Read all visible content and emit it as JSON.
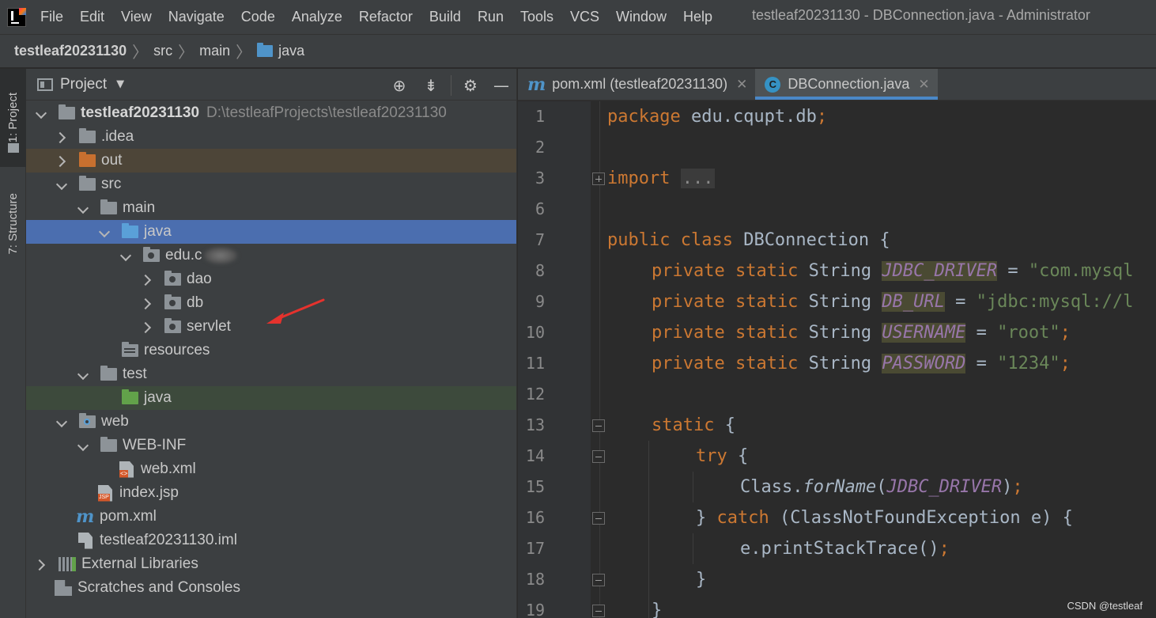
{
  "menu": {
    "items": [
      "File",
      "Edit",
      "View",
      "Navigate",
      "Code",
      "Analyze",
      "Refactor",
      "Build",
      "Run",
      "Tools",
      "VCS",
      "Window",
      "Help"
    ],
    "window_title": "testleaf20231130 - DBConnection.java - Administrator"
  },
  "breadcrumb": {
    "project": "testleaf20231130",
    "src": "src",
    "main": "main",
    "java": "java"
  },
  "side_strip": {
    "project_tab": "1: Project",
    "structure_tab": "7: Structure"
  },
  "project_panel": {
    "title": "Project",
    "tree": {
      "root_name": "testleaf20231130",
      "root_path": "D:\\testleafProjects\\testleaf20231130",
      "idea": ".idea",
      "out": "out",
      "src": "src",
      "main": "main",
      "java": "java",
      "edu_package": "edu.c",
      "dao": "dao",
      "db": "db",
      "servlet": "servlet",
      "resources": "resources",
      "test": "test",
      "test_java": "java",
      "web": "web",
      "web_inf": "WEB-INF",
      "web_xml": "web.xml",
      "index_jsp": "index.jsp",
      "pom_xml": "pom.xml",
      "iml": "testleaf20231130.iml",
      "external_libraries": "External Libraries",
      "scratches": "Scratches and Consoles"
    }
  },
  "editor": {
    "tabs": [
      {
        "label": "pom.xml (testleaf20231130)",
        "icon": "maven-icon"
      },
      {
        "label": "DBConnection.java",
        "icon": "class-icon"
      }
    ],
    "line_numbers": [
      "1",
      "2",
      "3",
      "6",
      "7",
      "8",
      "9",
      "10",
      "11",
      "12",
      "13",
      "14",
      "15",
      "16",
      "17",
      "18",
      "19"
    ],
    "code": {
      "l1_kw": "package",
      "l1_rest": " edu.cqupt.db",
      "l1_semi": ";",
      "l3_kw": "import",
      "l3_fold": "...",
      "l7_kw": "public class",
      "l7_rest": " DBConnection {",
      "l8_kw": "private static",
      "l8_type": " String ",
      "l8_field": "JDBC_DRIVER",
      "l8_eq": " = ",
      "l8_str": "\"com.mysql",
      "l9_kw": "private static",
      "l9_type": " String ",
      "l9_field": "DB_URL",
      "l9_eq": " = ",
      "l9_str": "\"jdbc:mysql://l",
      "l10_kw": "private static",
      "l10_type": " String ",
      "l10_field": "USERNAME",
      "l10_eq": " = ",
      "l10_str": "\"root\"",
      "l10_semi": ";",
      "l11_kw": "private static",
      "l11_type": " String ",
      "l11_field": "PASSWORD",
      "l11_eq": " = ",
      "l11_str": "\"1234\"",
      "l11_semi": ";",
      "l13_kw": "static",
      "l13_rest": " {",
      "l14_kw": "try",
      "l14_rest": " {",
      "l15_a": "Class.",
      "l15_fn": "forName",
      "l15_b": "(",
      "l15_field": "JDBC_DRIVER",
      "l15_c": ")",
      "l15_semi": ";",
      "l16_a": "} ",
      "l16_kw": "catch",
      "l16_rest": " (ClassNotFoundException e) {",
      "l17_a": "e.printStackTrace()",
      "l17_semi": ";",
      "l18_a": "}",
      "l19_a": "}"
    }
  },
  "watermark": "CSDN @testleaf",
  "colors": {
    "selection": "#4b6eaf",
    "keyword": "#cc7832",
    "string": "#6a8759",
    "field": "#9876aa",
    "arrow": "#e5322d"
  }
}
